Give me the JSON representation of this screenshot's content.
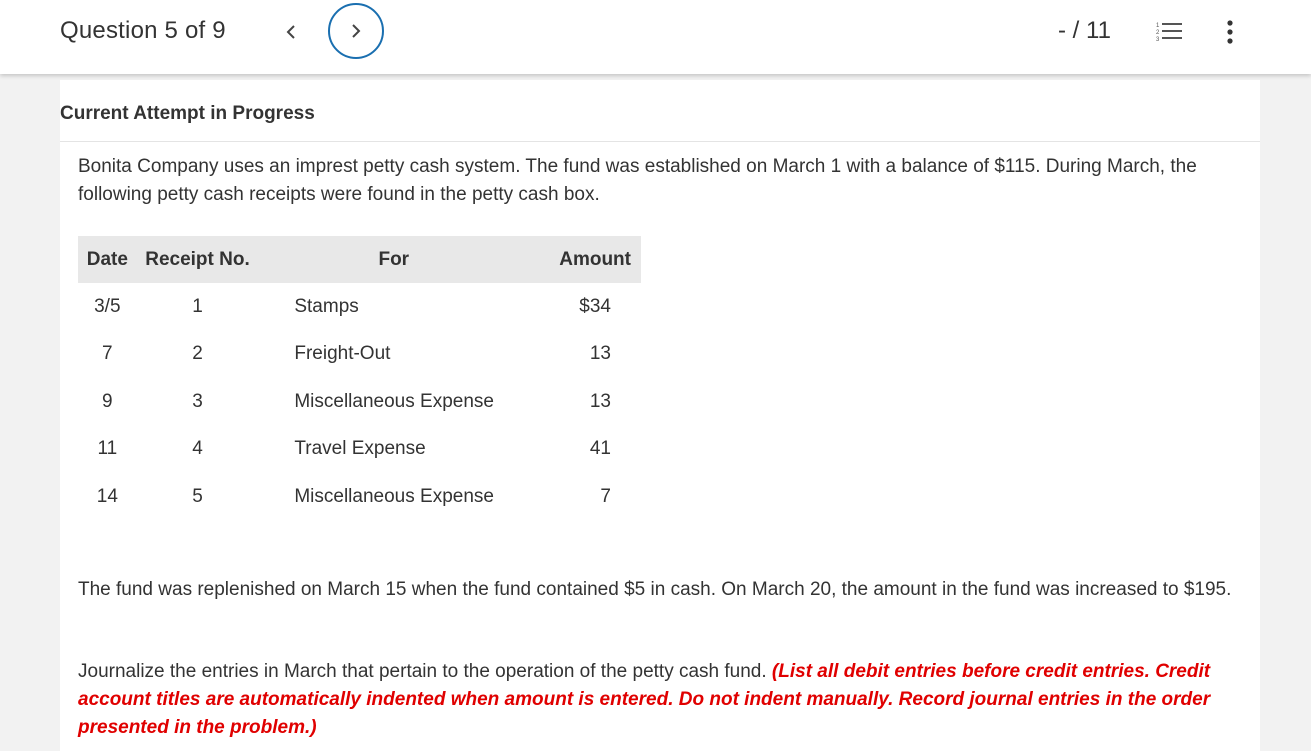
{
  "header": {
    "question_label": "Question 5 of 9",
    "score": "- / 11",
    "prev_icon": "chevron-left-icon",
    "next_icon": "chevron-right-icon",
    "list_icon": "numbered-list-icon",
    "more_icon": "more-vertical-icon",
    "accent_color": "#1a6fb0"
  },
  "content": {
    "attempt_title": "Current Attempt in Progress",
    "intro": "Bonita Company uses an imprest petty cash system. The fund was established on March 1 with a balance of $115. During March, the following petty cash receipts were found in the petty cash box.",
    "table": {
      "headers": {
        "date": "Date",
        "receipt": "Receipt No.",
        "for": "For",
        "amount": "Amount"
      },
      "rows": [
        {
          "date": "3/5",
          "receipt": "1",
          "for": "Stamps",
          "amount": "$34"
        },
        {
          "date": "7",
          "receipt": "2",
          "for": "Freight-Out",
          "amount": "13"
        },
        {
          "date": "9",
          "receipt": "3",
          "for": "Miscellaneous Expense",
          "amount": "13"
        },
        {
          "date": "11",
          "receipt": "4",
          "for": "Travel Expense",
          "amount": "41"
        },
        {
          "date": "14",
          "receipt": "5",
          "for": "Miscellaneous Expense",
          "amount": "7"
        }
      ]
    },
    "replenish_text": "The fund was replenished on March 15 when the fund contained $5 in cash. On March 20, the amount in the fund was increased to $195.",
    "journalize_text": "Journalize the entries in March that pertain to the operation of the petty cash fund. ",
    "instruction_text": "(List all debit entries before credit entries. Credit account titles are automatically indented when amount is entered. Do not indent manually. Record journal entries in the order presented in the problem.)",
    "instruction_color": "#e00000"
  }
}
